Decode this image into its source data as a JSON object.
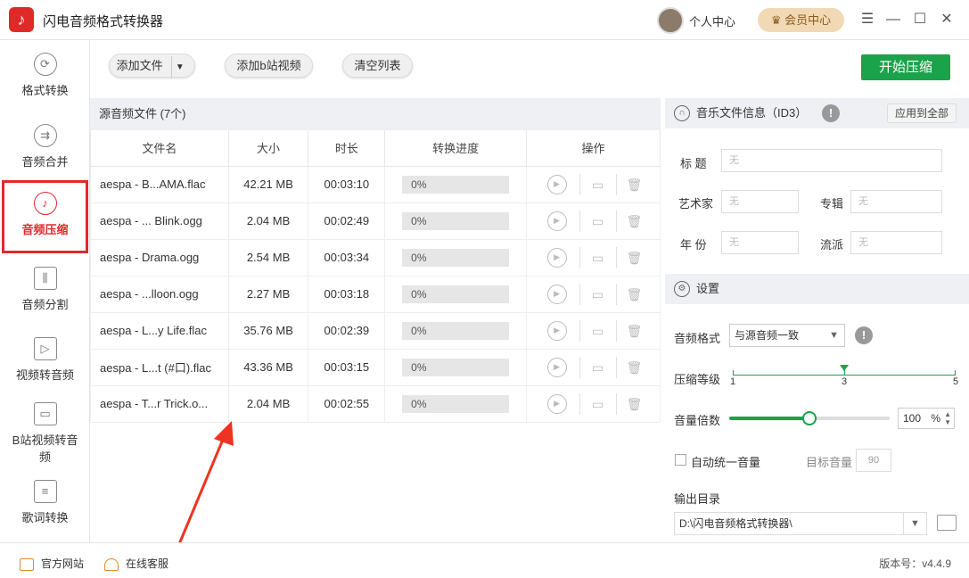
{
  "app": {
    "title": "闪电音频格式转换器",
    "logo_icon": "music-note-icon"
  },
  "header": {
    "user_center": "个人中心",
    "vip_center": "会员中心"
  },
  "sidebar": {
    "items": [
      {
        "label": "格式转换",
        "icon": "refresh-icon"
      },
      {
        "label": "音频合并",
        "icon": "merge-icon"
      },
      {
        "label": "音频压缩",
        "icon": "music-note-icon",
        "active": true
      },
      {
        "label": "音频分割",
        "icon": "split-icon"
      },
      {
        "label": "视频转音频",
        "icon": "video-icon"
      },
      {
        "label": "B站视频转音频",
        "icon": "tv-icon"
      },
      {
        "label": "歌词转换",
        "icon": "lyrics-icon"
      }
    ]
  },
  "toolbar": {
    "add_file": "添加文件",
    "add_bilibili": "添加b站视频",
    "clear_list": "清空列表",
    "start": "开始压缩"
  },
  "file_list": {
    "header": "源音频文件 (7个)",
    "columns": [
      "文件名",
      "大小",
      "时长",
      "转换进度",
      "操作"
    ],
    "rows": [
      {
        "name": "aespa - B...AMA.flac",
        "size": "42.21 MB",
        "duration": "00:03:10",
        "progress": "0%"
      },
      {
        "name": "aespa - ... Blink.ogg",
        "size": "2.04 MB",
        "duration": "00:02:49",
        "progress": "0%"
      },
      {
        "name": "aespa - Drama.ogg",
        "size": "2.54 MB",
        "duration": "00:03:34",
        "progress": "0%"
      },
      {
        "name": "aespa - ...lloon.ogg",
        "size": "2.27 MB",
        "duration": "00:03:18",
        "progress": "0%"
      },
      {
        "name": "aespa - L...y Life.flac",
        "size": "35.76 MB",
        "duration": "00:02:39",
        "progress": "0%"
      },
      {
        "name": "aespa - L...t (#口).flac",
        "size": "43.36 MB",
        "duration": "00:03:15",
        "progress": "0%"
      },
      {
        "name": "aespa - T...r Trick.o...",
        "size": "2.04 MB",
        "duration": "00:02:55",
        "progress": "0%"
      }
    ]
  },
  "id3": {
    "title": "音乐文件信息（ID3）",
    "apply_all": "应用到全部",
    "fields": {
      "song_title_label": "标 题",
      "song_title_value": "无",
      "artist_label": "艺术家",
      "artist_value": "无",
      "album_label": "专辑",
      "album_value": "无",
      "year_label": "年 份",
      "year_value": "无",
      "genre_label": "流派",
      "genre_value": "无"
    }
  },
  "settings": {
    "title": "设置",
    "format_label": "音频格式",
    "format_value": "与源音频一致",
    "level_label": "压缩等级",
    "level_ticks": [
      "1",
      "3",
      "5"
    ],
    "level_value": 3,
    "volume_label": "音量倍数",
    "volume_value": "100",
    "volume_unit": "%",
    "volume_fraction": 0.5,
    "auto_volume_label": "自动统一音量",
    "target_volume_label": "目标音量",
    "target_volume_value": "90",
    "output_label": "输出目录",
    "output_path": "D:\\闪电音频格式转换器\\"
  },
  "footer": {
    "website": "官方网站",
    "support": "在线客服",
    "version": "版本号：v4.4.9"
  },
  "colors": {
    "accent": "#1aa34a",
    "brand": "#e02a2a",
    "vip": "#f2d9b5"
  }
}
